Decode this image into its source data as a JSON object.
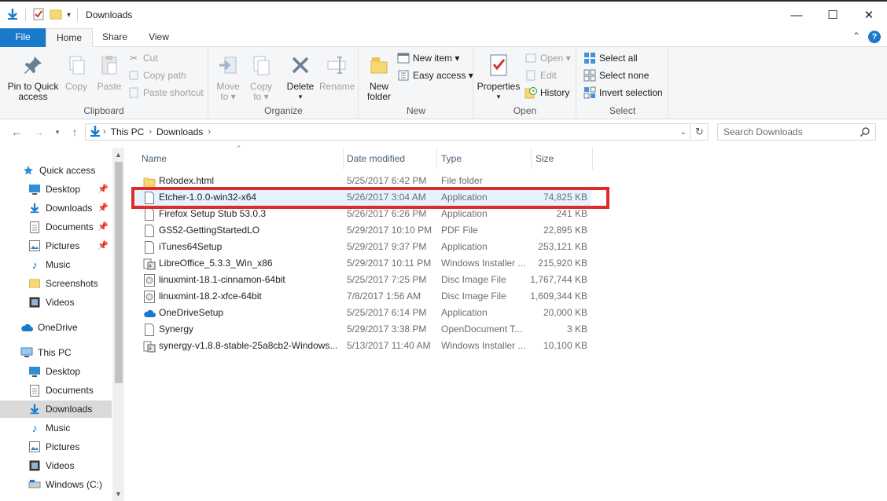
{
  "window": {
    "title": "Downloads",
    "controls": [
      "—",
      "☐",
      "✕"
    ]
  },
  "tabs": {
    "file": "File",
    "home": "Home",
    "share": "Share",
    "view": "View"
  },
  "ribbon": {
    "clipboard": {
      "label": "Clipboard",
      "pin": "Pin to Quick access",
      "pin_l1": "Pin to Quick",
      "pin_l2": "access",
      "copy": "Copy",
      "paste": "Paste",
      "cut": "Cut",
      "copy_path": "Copy path",
      "paste_shortcut": "Paste shortcut"
    },
    "organize": {
      "label": "Organize",
      "move_to_l1": "Move",
      "move_to_l2": "to ▾",
      "copy_to_l1": "Copy",
      "copy_to_l2": "to ▾",
      "delete": "Delete",
      "delete_arrow": "▾",
      "rename": "Rename"
    },
    "new": {
      "label": "New",
      "new_folder_l1": "New",
      "new_folder_l2": "folder",
      "new_item": "New item ▾",
      "easy_access": "Easy access ▾"
    },
    "open": {
      "label": "Open",
      "properties": "Properties",
      "properties_arrow": "▾",
      "open": "Open ▾",
      "edit": "Edit",
      "history": "History"
    },
    "select": {
      "label": "Select",
      "select_all": "Select all",
      "select_none": "Select none",
      "invert": "Invert selection"
    }
  },
  "address": {
    "crumbs": [
      "This PC",
      "Downloads"
    ],
    "search_placeholder": "Search Downloads"
  },
  "nav": {
    "quick_access": "Quick access",
    "qa_desktop": "Desktop",
    "qa_downloads": "Downloads",
    "qa_documents": "Documents",
    "qa_pictures": "Pictures",
    "qa_music": "Music",
    "qa_screenshots": "Screenshots",
    "qa_videos": "Videos",
    "onedrive": "OneDrive",
    "this_pc": "This PC",
    "pc_desktop": "Desktop",
    "pc_documents": "Documents",
    "pc_downloads": "Downloads",
    "pc_music": "Music",
    "pc_pictures": "Pictures",
    "pc_videos": "Videos",
    "pc_windows": "Windows (C:)"
  },
  "columns": {
    "name": "Name",
    "date": "Date modified",
    "type": "Type",
    "size": "Size"
  },
  "files": [
    {
      "name": "Rolodex.html",
      "date": "5/25/2017 6:42 PM",
      "type": "File folder",
      "size": "",
      "icon": "folder-icon"
    },
    {
      "name": "Etcher-1.0.0-win32-x64",
      "date": "5/26/2017 3:04 AM",
      "type": "Application",
      "size": "74,825 KB",
      "icon": "file-icon"
    },
    {
      "name": "Firefox Setup Stub 53.0.3",
      "date": "5/26/2017 6:26 PM",
      "type": "Application",
      "size": "241 KB",
      "icon": "file-icon"
    },
    {
      "name": "GS52-GettingStartedLO",
      "date": "5/29/2017 10:10 PM",
      "type": "PDF File",
      "size": "22,895 KB",
      "icon": "file-icon"
    },
    {
      "name": "iTunes64Setup",
      "date": "5/29/2017 9:37 PM",
      "type": "Application",
      "size": "253,121 KB",
      "icon": "file-icon"
    },
    {
      "name": "LibreOffice_5.3.3_Win_x86",
      "date": "5/29/2017 10:11 PM",
      "type": "Windows Installer ...",
      "size": "215,920 KB",
      "icon": "installer-icon"
    },
    {
      "name": "linuxmint-18.1-cinnamon-64bit",
      "date": "5/25/2017 7:25 PM",
      "type": "Disc Image File",
      "size": "1,767,744 KB",
      "icon": "disc-image-icon"
    },
    {
      "name": "linuxmint-18.2-xfce-64bit",
      "date": "7/8/2017 1:56 AM",
      "type": "Disc Image File",
      "size": "1,609,344 KB",
      "icon": "disc-image-icon"
    },
    {
      "name": "OneDriveSetup",
      "date": "5/25/2017 6:14 PM",
      "type": "Application",
      "size": "20,000 KB",
      "icon": "onedrive-setup-icon"
    },
    {
      "name": "Synergy",
      "date": "5/29/2017 3:38 PM",
      "type": "OpenDocument T...",
      "size": "3 KB",
      "icon": "file-icon"
    },
    {
      "name": "synergy-v1.8.8-stable-25a8cb2-Windows...",
      "date": "5/13/2017 11:40 AM",
      "type": "Windows Installer ...",
      "size": "10,100 KB",
      "icon": "installer-icon"
    }
  ],
  "colors": {
    "accent": "#1979ca",
    "highlight": "#e02b2b",
    "hover_row": "#e5f3ff"
  }
}
